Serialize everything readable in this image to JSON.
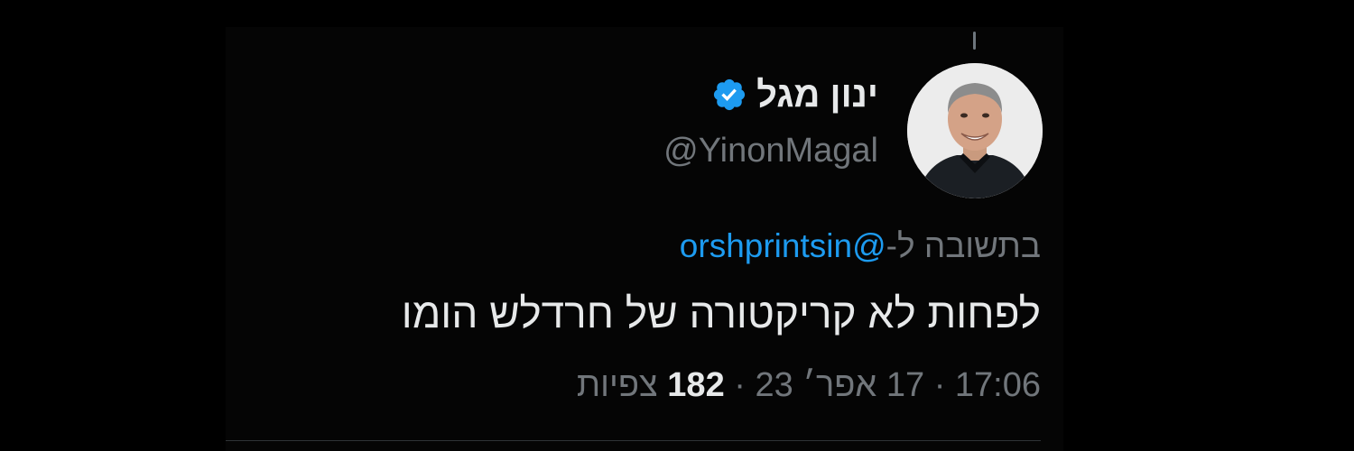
{
  "tweet": {
    "author": {
      "display_name": "ינון מגל",
      "handle": "@YinonMagal",
      "verified": true
    },
    "reply_to": {
      "prefix": "בתשובה ל-",
      "mention": "@orshprintsin"
    },
    "text": "לפחות לא קריקטורה של חרדלש הומו",
    "meta": {
      "time": "17:06",
      "date": "17 אפר׳ 23",
      "views_count": "182",
      "views_label": "צפיות",
      "separator": "·"
    }
  },
  "colors": {
    "background": "#000000",
    "text": "#e7e9ea",
    "secondary": "#71767b",
    "link": "#1d9bf0",
    "verified_badge": "#1d9bf0"
  },
  "icons": {
    "verified": "verified-badge-icon",
    "avatar": "profile-photo"
  }
}
